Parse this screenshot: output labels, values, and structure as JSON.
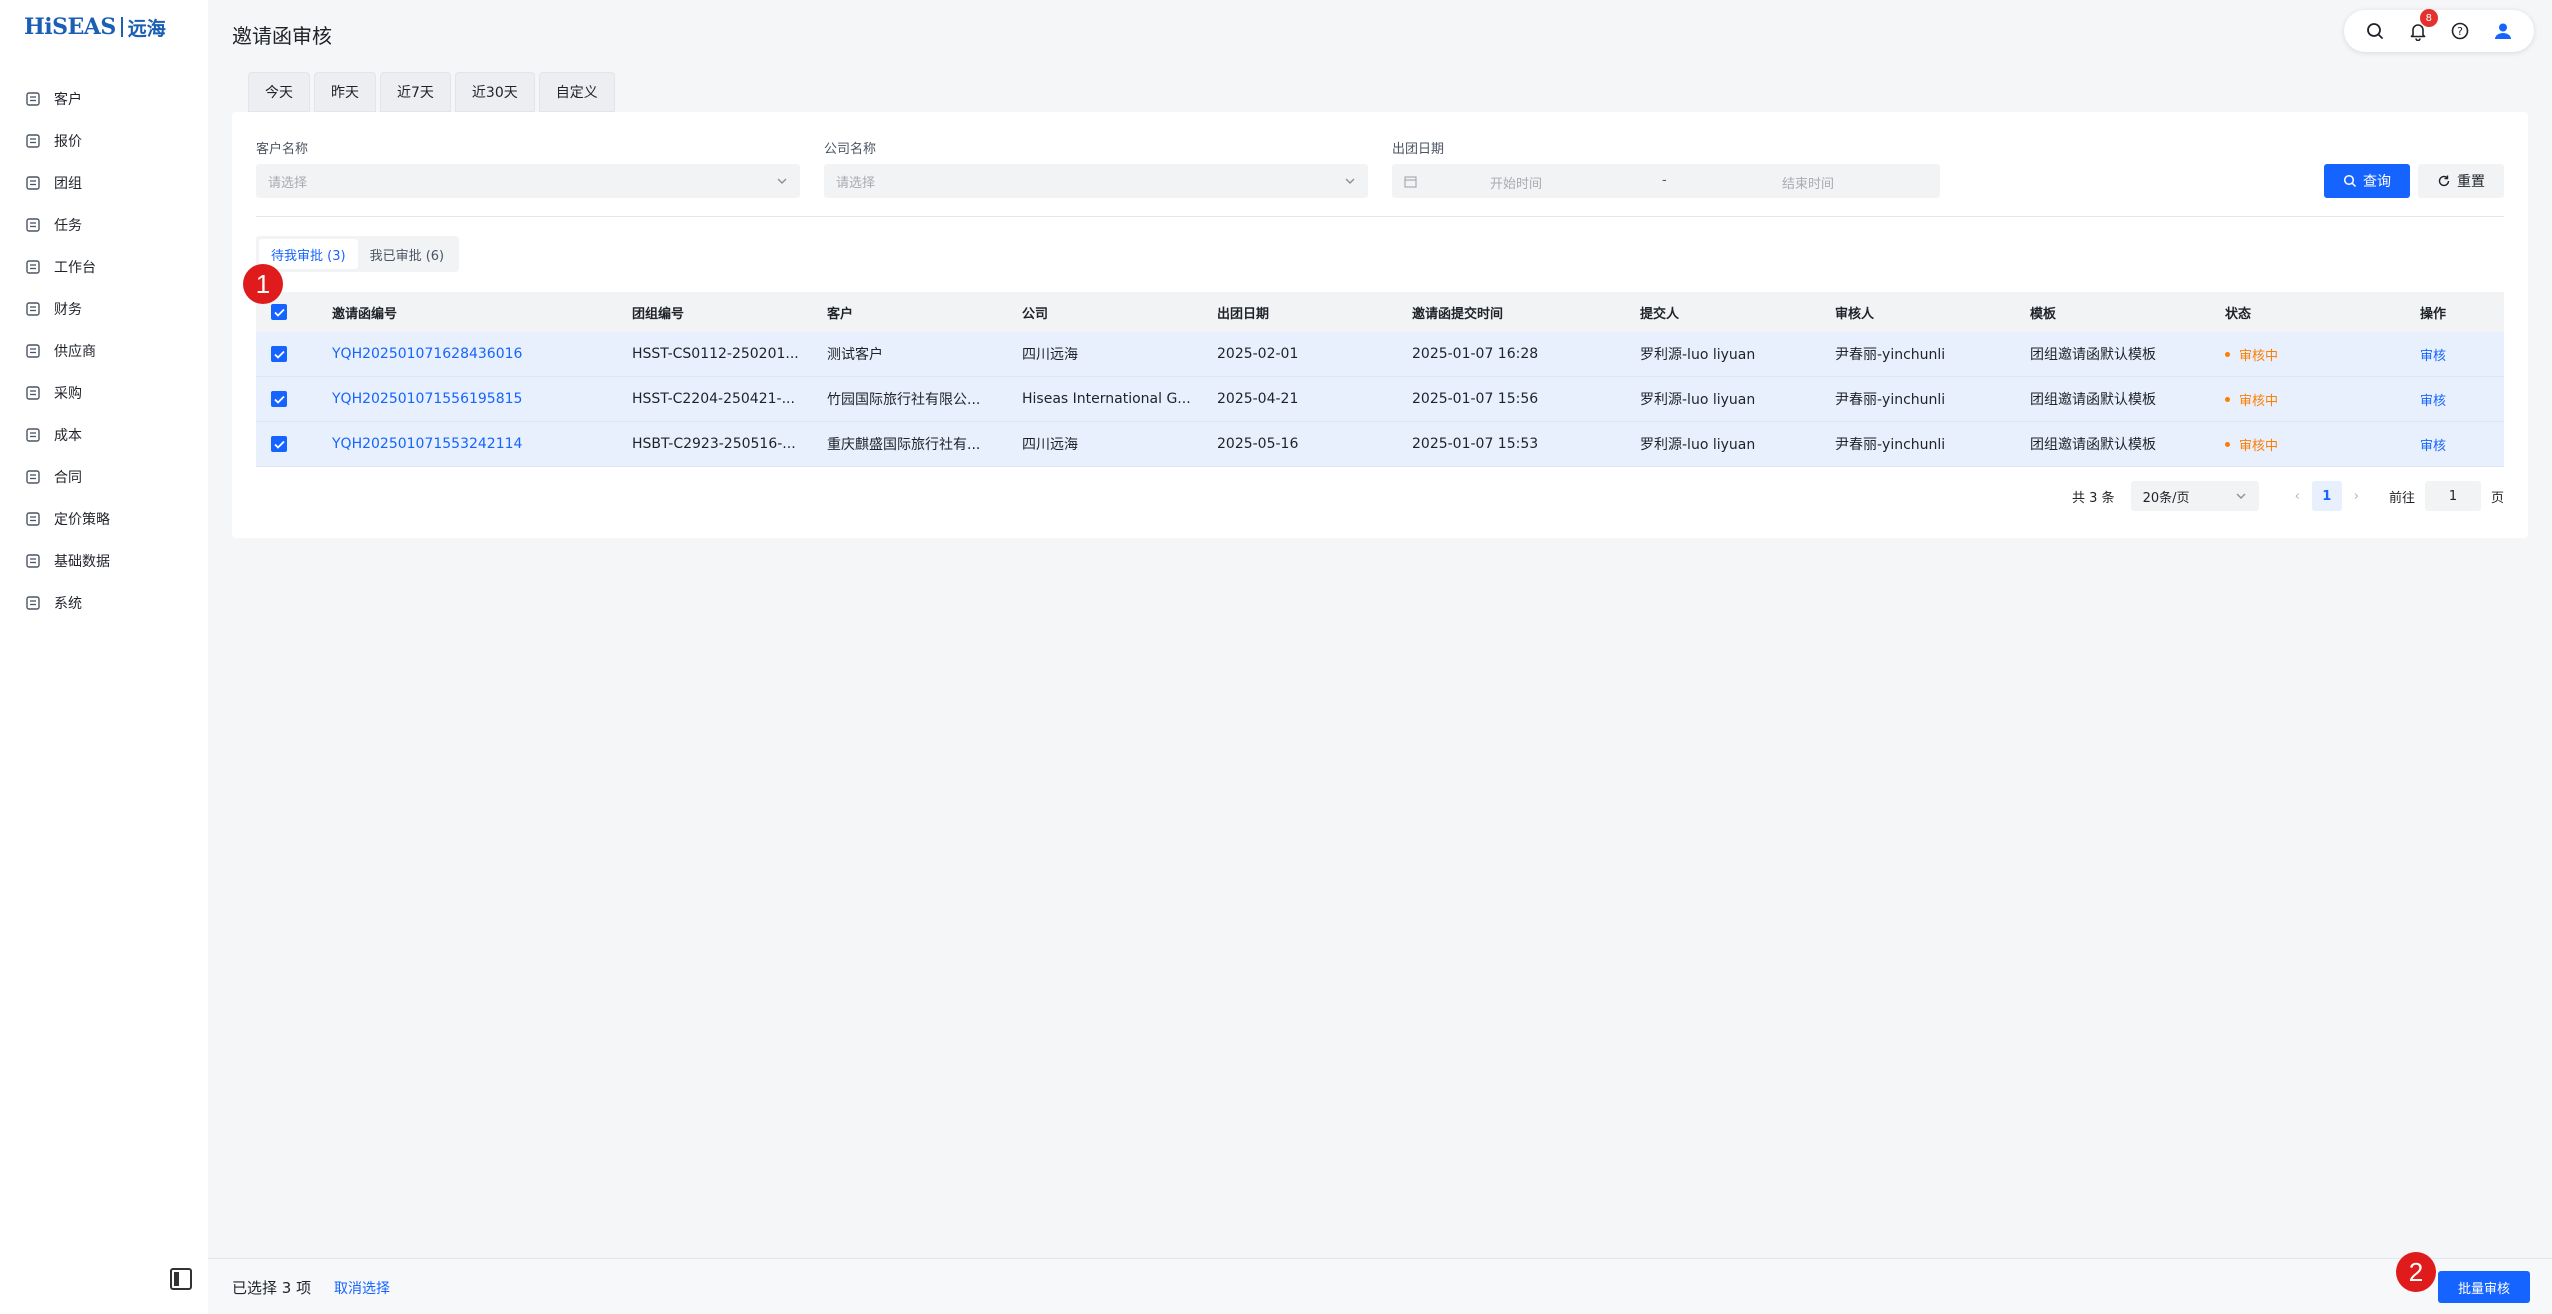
{
  "brand": {
    "logo_text": "HiSEAS",
    "logo_cn": "远海"
  },
  "sidebar": {
    "items": [
      {
        "label": "客户",
        "icon": "customer-icon"
      },
      {
        "label": "报价",
        "icon": "quote-icon"
      },
      {
        "label": "团组",
        "icon": "group-icon"
      },
      {
        "label": "任务",
        "icon": "task-icon"
      },
      {
        "label": "工作台",
        "icon": "workbench-icon"
      },
      {
        "label": "财务",
        "icon": "finance-icon"
      },
      {
        "label": "供应商",
        "icon": "supplier-icon"
      },
      {
        "label": "采购",
        "icon": "purchase-icon"
      },
      {
        "label": "成本",
        "icon": "cost-icon"
      },
      {
        "label": "合同",
        "icon": "contract-icon"
      },
      {
        "label": "定价策略",
        "icon": "pricing-icon"
      },
      {
        "label": "基础数据",
        "icon": "basic-data-icon"
      },
      {
        "label": "系统",
        "icon": "system-icon"
      }
    ]
  },
  "header": {
    "title": "邀请函审核",
    "notification_count": "8"
  },
  "date_tabs": [
    "今天",
    "昨天",
    "近7天",
    "近30天",
    "自定义"
  ],
  "filters": {
    "customer_label": "客户名称",
    "customer_placeholder": "请选择",
    "company_label": "公司名称",
    "company_placeholder": "请选择",
    "date_label": "出团日期",
    "start_placeholder": "开始时间",
    "range_sep": "-",
    "end_placeholder": "结束时间",
    "query_label": "查询",
    "reset_label": "重置"
  },
  "segments": {
    "pending": "待我审批 (3)",
    "done": "我已审批 (6)"
  },
  "table": {
    "columns": [
      "邀请函编号",
      "团组编号",
      "客户",
      "公司",
      "出团日期",
      "邀请函提交时间",
      "提交人",
      "审核人",
      "模板",
      "状态",
      "操作"
    ],
    "rows": [
      {
        "id": "YQH202501071628436016",
        "group": "HSST-CS0112-250201...",
        "customer": "测试客户",
        "company": "四川远海",
        "date": "2025-02-01",
        "submitted": "2025-01-07 16:28",
        "submitter": "罗利源-luo liyuan",
        "reviewer": "尹春丽-yinchunli",
        "template": "团组邀请函默认模板",
        "status": "审核中",
        "action": "审核"
      },
      {
        "id": "YQH202501071556195815",
        "group": "HSST-C2204-250421-...",
        "customer": "竹园国际旅行社有限公...",
        "company": "Hiseas International G...",
        "date": "2025-04-21",
        "submitted": "2025-01-07 15:56",
        "submitter": "罗利源-luo liyuan",
        "reviewer": "尹春丽-yinchunli",
        "template": "团组邀请函默认模板",
        "status": "审核中",
        "action": "审核"
      },
      {
        "id": "YQH202501071553242114",
        "group": "HSBT-C2923-250516-...",
        "customer": "重庆麒盛国际旅行社有...",
        "company": "四川远海",
        "date": "2025-05-16",
        "submitted": "2025-01-07 15:53",
        "submitter": "罗利源-luo liyuan",
        "reviewer": "尹春丽-yinchunli",
        "template": "团组邀请函默认模板",
        "status": "审核中",
        "action": "审核"
      }
    ]
  },
  "pagination": {
    "total": "共 3 条",
    "page_size": "20条/页",
    "current": "1",
    "goto_label": "前往",
    "goto_value": "1",
    "page_suffix": "页"
  },
  "footer": {
    "selected": "已选择 3 项",
    "cancel": "取消选择",
    "batch": "批量审核"
  },
  "markers": [
    "1",
    "2"
  ],
  "colors": {
    "primary": "#1664ff",
    "status_pending": "#ff7d00",
    "marker": "#e01b1b"
  }
}
